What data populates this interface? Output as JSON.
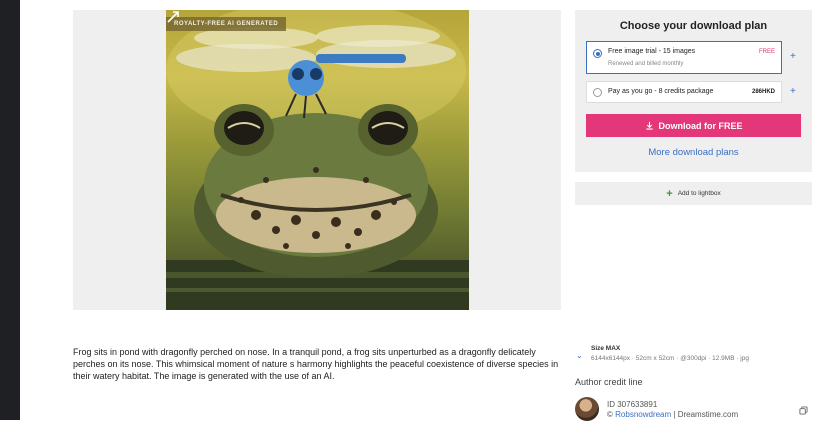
{
  "image": {
    "badge": "ROYALTY-FREE AI GENERATED"
  },
  "plan": {
    "title": "Choose your download plan",
    "options": [
      {
        "label": "Free image trial - 15 images",
        "sublabel": "Renewed and billed monthly",
        "price": "FREE",
        "selected": true
      },
      {
        "label": "Pay as you go - 8 credits package",
        "price": "286HKD",
        "selected": false
      }
    ],
    "download_label": "Download for FREE",
    "more_label": "More download plans"
  },
  "lightbox": {
    "label": "Add to lightbox"
  },
  "description": "Frog sits in pond with dragonfly perched on nose. In a tranquil pond, a frog sits unperturbed as a dragonfly delicately perches on its nose. This whimsical moment of nature s harmony highlights the peaceful coexistence of diverse species in their watery habitat. The image is generated with the use of an AI.",
  "size": {
    "title": "Size MAX",
    "detail": "6144x6144px · 52cm x 52cm · @300dpi · 12.9MB · jpg"
  },
  "credit": {
    "heading": "Author credit line",
    "id": "ID 307633891",
    "author": "Robsnowdream",
    "separator": " | ",
    "site": "Dreamstime.com",
    "copyright": "©"
  },
  "colors": {
    "accent_blue": "#3b6fc2",
    "download_pink": "#e3377a",
    "free_pink": "#e0336e",
    "panel_gray": "#efefef",
    "left_strip": "#1f2024"
  },
  "icons": [
    "download-icon",
    "plus-icon",
    "chevron-down-icon",
    "copy-icon",
    "zoom-icon"
  ]
}
